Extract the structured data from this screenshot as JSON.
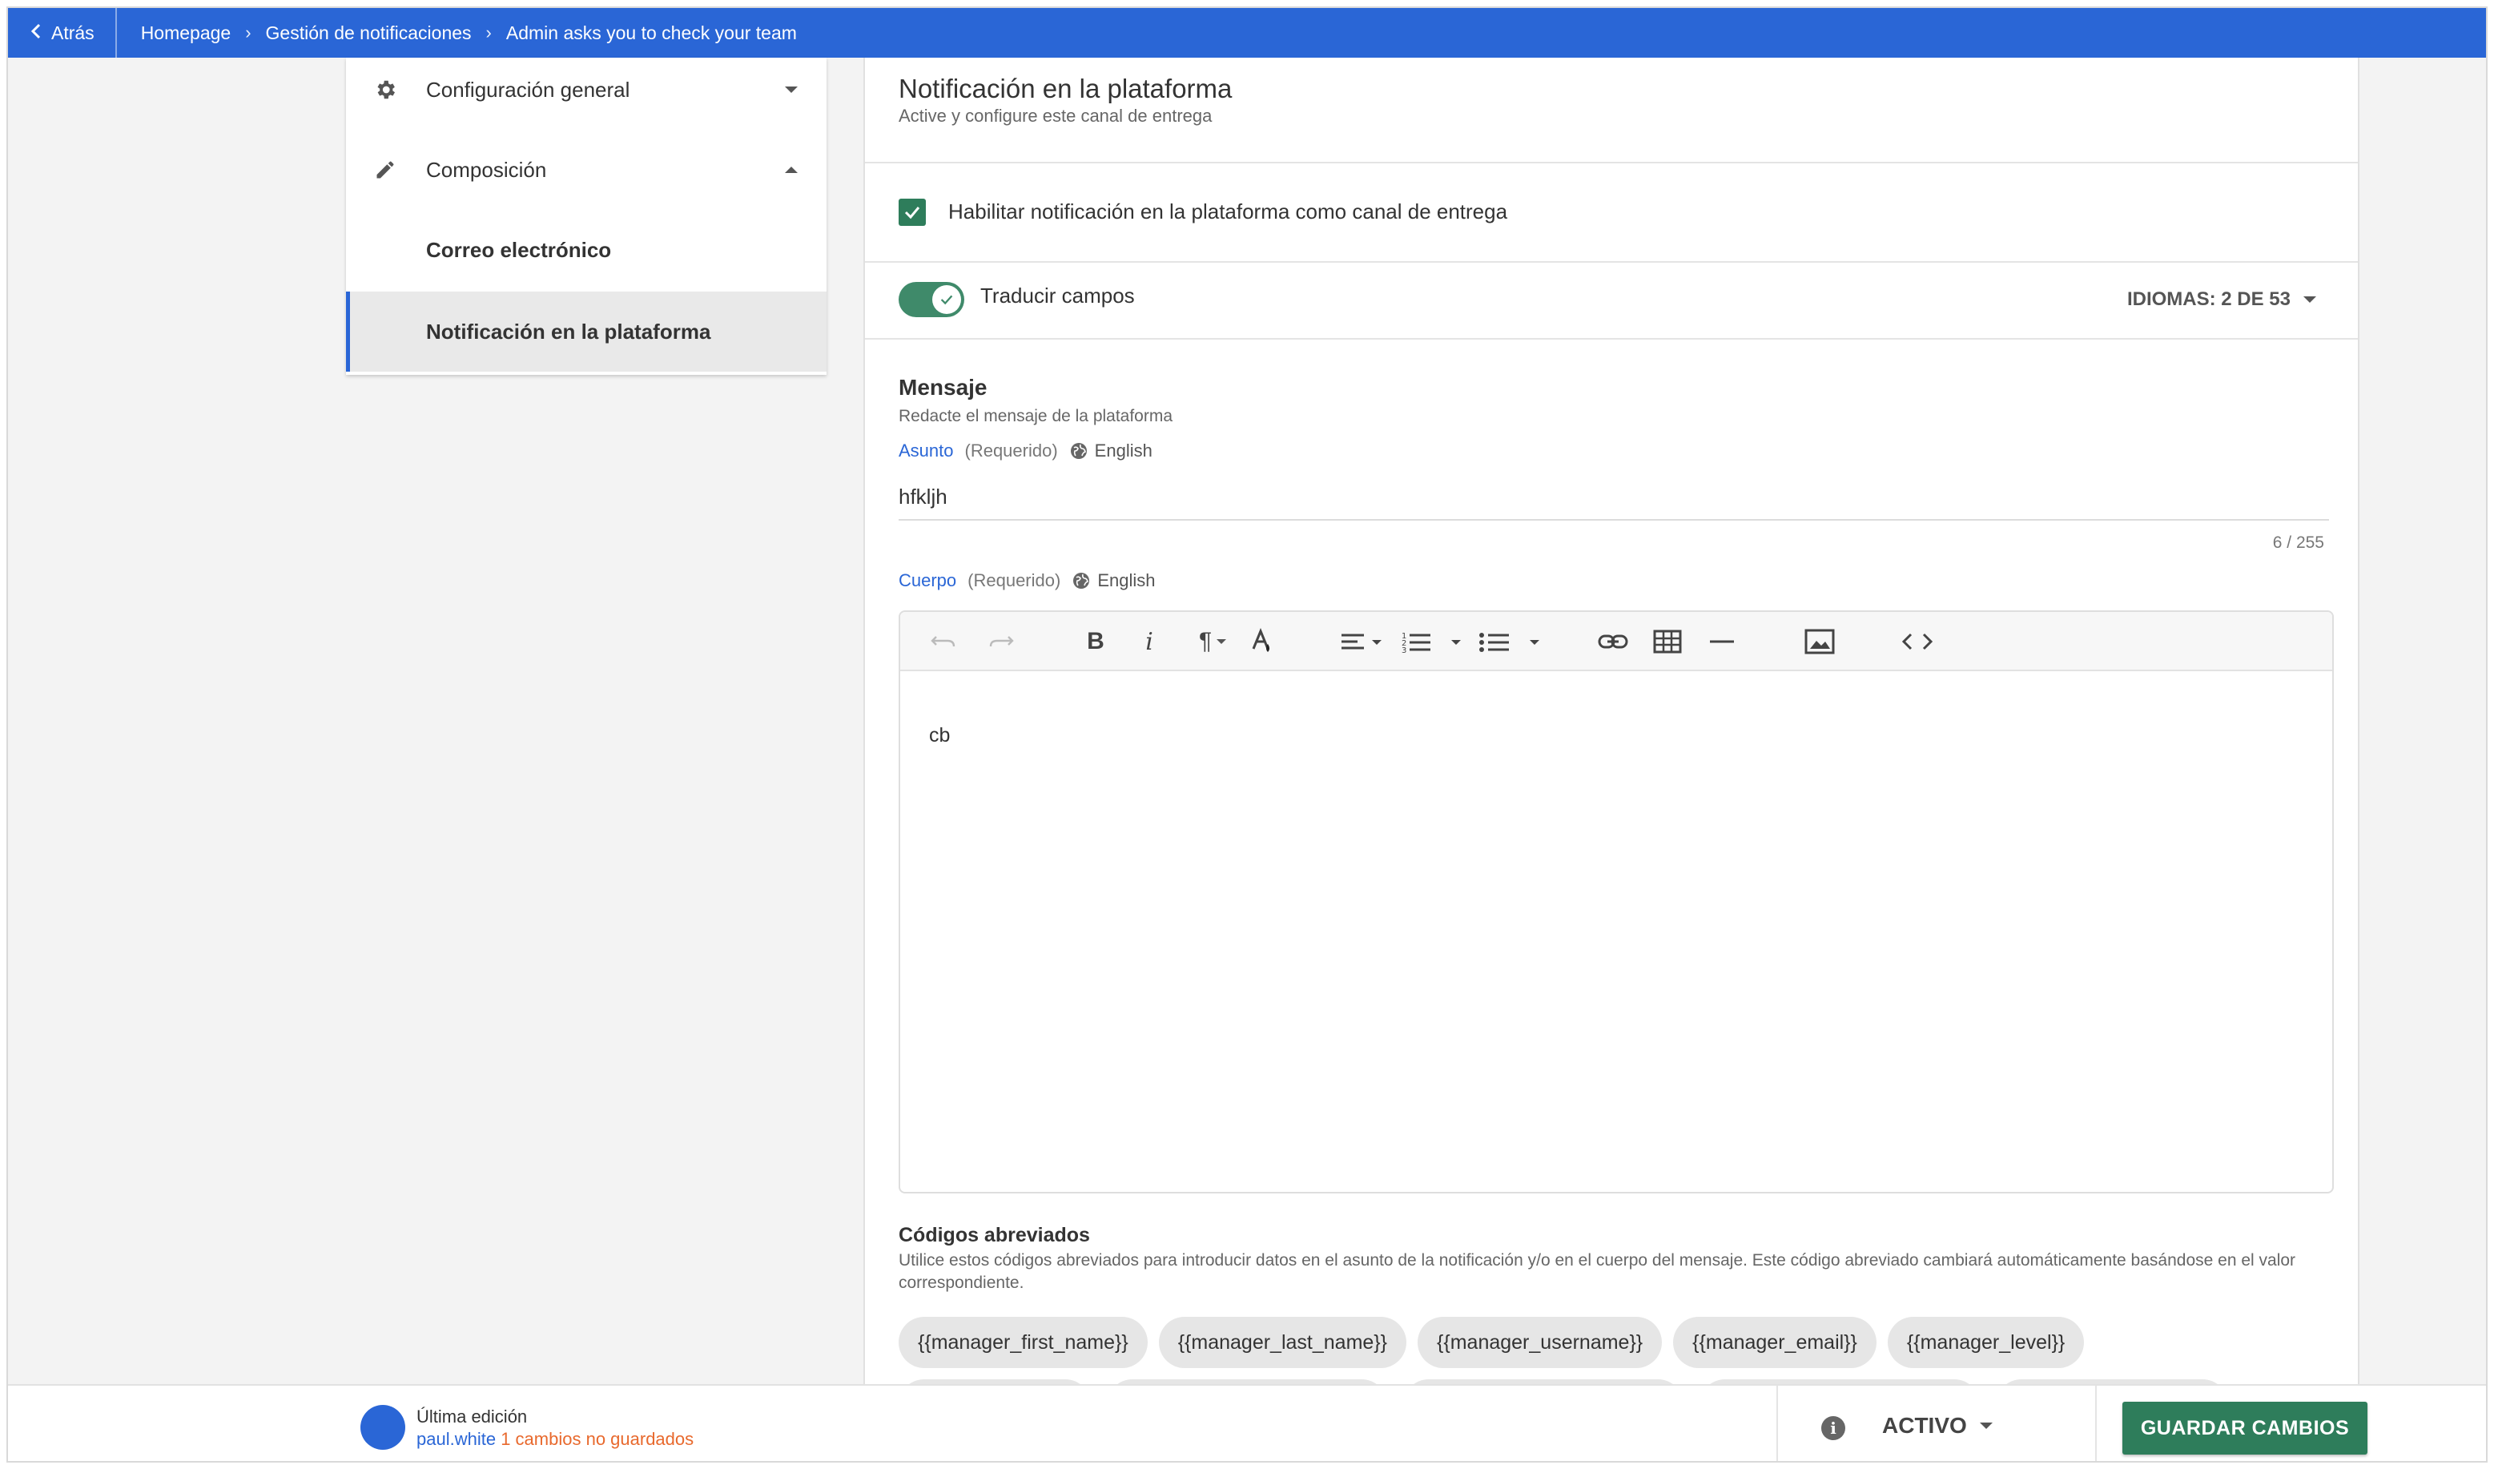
{
  "topbar": {
    "back_label": "Atrás",
    "breadcrumbs": [
      "Homepage",
      "Gestión de notificaciones",
      "Admin asks you to check your team"
    ]
  },
  "sidebar": {
    "items": [
      {
        "label": "Configuración general",
        "icon": "gear-icon",
        "expanded": false
      },
      {
        "label": "Composición",
        "icon": "pencil-icon",
        "expanded": true
      },
      {
        "label": "Correo electrónico"
      },
      {
        "label": "Notificación en la plataforma",
        "active": true
      }
    ]
  },
  "main": {
    "title": "Notificación en la plataforma",
    "subtitle": "Active y configure este canal de entrega",
    "enable_channel_label": "Habilitar notificación en la plataforma como canal de entrega",
    "enable_channel_checked": true,
    "translate_label": "Traducir campos",
    "translate_on": true,
    "languages_label": "IDIOMAS: 2 DE 53",
    "message_title": "Mensaje",
    "message_subtitle": "Redacte el mensaje de la plataforma",
    "subject": {
      "label": "Asunto",
      "required": "(Requerido)",
      "language": "English",
      "value": "hfkljh",
      "counter": "6 / 255"
    },
    "body": {
      "label": "Cuerpo",
      "required": "(Requerido)",
      "language": "English",
      "content": "cb"
    },
    "shortcodes_title": "Códigos abreviados",
    "shortcodes_description": "Utilice estos códigos abreviados para introducir datos en el asunto de la notificación y/o en el cuerpo del mensaje. Este código abreviado cambiará automáticamente basándose en el valor correspondiente.",
    "shortcodes": [
      "{{manager_first_name}}",
      "{{manager_last_name}}",
      "{{manager_username}}",
      "{{manager_email}}",
      "{{manager_level}}"
    ]
  },
  "footer": {
    "last_edit_label": "Última edición",
    "user": "paul.white",
    "unsaved": "1 cambios no guardados",
    "status": "ACTIVO",
    "save_label": "GUARDAR CAMBIOS"
  },
  "colors": {
    "primary": "#2a66d6",
    "success": "#2e7d5b",
    "warning": "#e8692d"
  }
}
